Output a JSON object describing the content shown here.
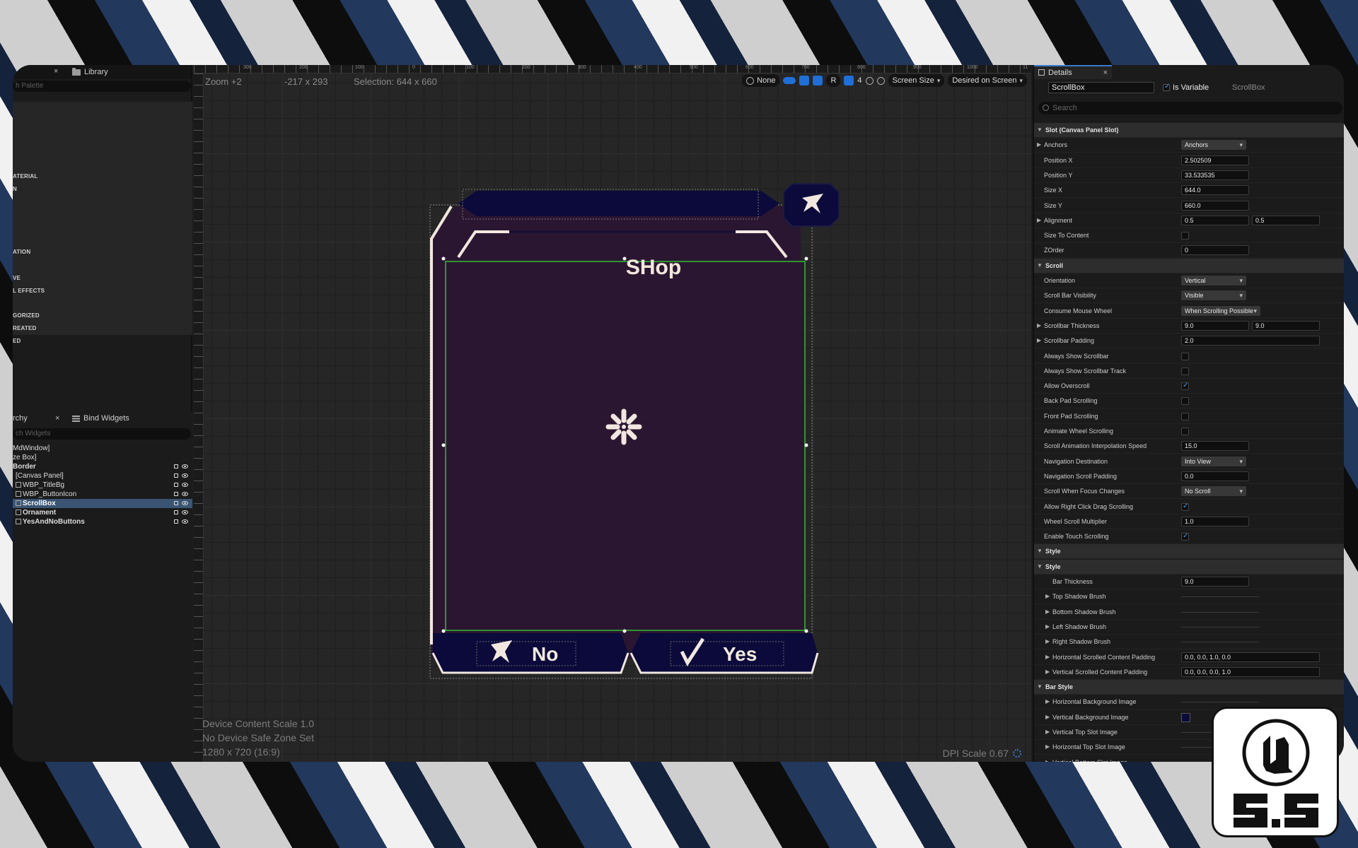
{
  "colors": {
    "accent": "#3b7ac8",
    "widget_fill": "#2b1632",
    "widget_header": "#0b0a3a",
    "widget_border": "#f1e7df",
    "selection": "#2fbf2f"
  },
  "palette": {
    "close_glyph": "×",
    "library_tab": "Library",
    "search_placeholder": "h Palette",
    "categories": [
      "ATERIAL",
      "N",
      "ATION",
      "VE",
      "L EFFECTS",
      "GORIZED",
      "REATED",
      "ED"
    ]
  },
  "hierarchy": {
    "tab_label": "rchy",
    "close_glyph": "×",
    "bind_tab": "Bind Widgets",
    "search_placeholder": "ch Widgets",
    "items": [
      {
        "label": "MdWindow]"
      },
      {
        "label": "ze Box]"
      },
      {
        "label": "Border"
      },
      {
        "label": "[Canvas Panel]"
      },
      {
        "label": "WBP_TitleBg"
      },
      {
        "label": "WBP_ButtonIcon"
      },
      {
        "label": "ScrollBox"
      },
      {
        "label": "Ornament"
      },
      {
        "label": "YesAndNoButtons"
      }
    ]
  },
  "viewport": {
    "zoom": "Zoom +2",
    "cursor": "-217 x 293",
    "selection": "Selection: 644 x 660",
    "ruler_marks": [
      "300",
      "200",
      "100",
      "0",
      "100",
      "200",
      "300",
      "400",
      "500",
      "600",
      "700",
      "800",
      "900",
      "1000",
      "11"
    ],
    "toolbar": {
      "none_label": "None",
      "r_label": "R",
      "grid_value": "4",
      "screen_size": "Screen Size",
      "desired": "Desired on Screen"
    },
    "footer": {
      "scale": "Device Content Scale 1.0",
      "safe_zone": "No Device Safe Zone Set",
      "resolution": "1280 x 720 (16:9)",
      "dpi": "DPI Scale 0.67"
    }
  },
  "widget": {
    "title": "SHop",
    "no_label": "No",
    "yes_label": "Yes",
    "close_icon": "x-mark-icon",
    "loading_icon": "asterisk-loading-icon"
  },
  "details": {
    "tab": "Details",
    "close_glyph": "×",
    "name": "ScrollBox",
    "is_variable": "Is Variable",
    "type": "ScrollBox",
    "search_placeholder": "Search",
    "rows": [
      {
        "kind": "section",
        "label": "Slot (Canvas Panel Slot)"
      },
      {
        "kind": "dropdown",
        "label": "Anchors",
        "value": "Anchors",
        "expand": true
      },
      {
        "kind": "text",
        "label": "Position X",
        "value": "2.502509"
      },
      {
        "kind": "text",
        "label": "Position Y",
        "value": "33.533535"
      },
      {
        "kind": "text",
        "label": "Size X",
        "value": "644.0"
      },
      {
        "kind": "text",
        "label": "Size Y",
        "value": "660.0"
      },
      {
        "kind": "pair",
        "label": "Alignment",
        "value": "0.5",
        "value2": "0.5",
        "expand": true
      },
      {
        "kind": "check",
        "label": "Size To Content",
        "checked": false
      },
      {
        "kind": "text",
        "label": "ZOrder",
        "value": "0"
      },
      {
        "kind": "section",
        "label": "Scroll"
      },
      {
        "kind": "dropdown",
        "label": "Orientation",
        "value": "Vertical"
      },
      {
        "kind": "dropdown",
        "label": "Scroll Bar Visibility",
        "value": "Visible"
      },
      {
        "kind": "dropdown",
        "label": "Consume Mouse Wheel",
        "value": "When Scrolling Possible"
      },
      {
        "kind": "pair",
        "label": "Scrollbar Thickness",
        "value": "9.0",
        "value2": "9.0",
        "expand": true
      },
      {
        "kind": "wide",
        "label": "Scrollbar Padding",
        "value": "2.0",
        "expand": true
      },
      {
        "kind": "check",
        "label": "Always Show Scrollbar",
        "checked": false
      },
      {
        "kind": "check",
        "label": "Always Show Scrollbar Track",
        "checked": false
      },
      {
        "kind": "check",
        "label": "Allow Overscroll",
        "checked": true
      },
      {
        "kind": "check",
        "label": "Back Pad Scrolling",
        "checked": false
      },
      {
        "kind": "check",
        "label": "Front Pad Scrolling",
        "checked": false
      },
      {
        "kind": "check",
        "label": "Animate Wheel Scrolling",
        "checked": false
      },
      {
        "kind": "text",
        "label": "Scroll Animation Interpolation Speed",
        "value": "15.0"
      },
      {
        "kind": "dropdown",
        "label": "Navigation Destination",
        "value": "Into View"
      },
      {
        "kind": "text",
        "label": "Navigation Scroll Padding",
        "value": "0.0"
      },
      {
        "kind": "dropdown",
        "label": "Scroll When Focus Changes",
        "value": "No Scroll"
      },
      {
        "kind": "check",
        "label": "Allow Right Click Drag Scrolling",
        "checked": true
      },
      {
        "kind": "text",
        "label": "Wheel Scroll Multiplier",
        "value": "1.0"
      },
      {
        "kind": "check",
        "label": "Enable Touch Scrolling",
        "checked": true
      },
      {
        "kind": "section",
        "label": "Style"
      },
      {
        "kind": "subsection",
        "label": "Style"
      },
      {
        "kind": "text",
        "label": "Bar Thickness",
        "value": "9.0",
        "indent": true
      },
      {
        "kind": "brush",
        "label": "Top Shadow Brush"
      },
      {
        "kind": "brush",
        "label": "Bottom Shadow Brush"
      },
      {
        "kind": "brush",
        "label": "Left Shadow Brush"
      },
      {
        "kind": "brush",
        "label": "Right Shadow Brush"
      },
      {
        "kind": "widebrush",
        "label": "Horizontal Scrolled Content Padding",
        "value": "0.0, 0.0, 1.0, 0.0"
      },
      {
        "kind": "widebrush",
        "label": "Vertical Scrolled Content Padding",
        "value": "0.0, 0.0, 0.0, 1.0"
      },
      {
        "kind": "subsection",
        "label": "Bar Style"
      },
      {
        "kind": "brush",
        "label": "Horizontal Background Image"
      },
      {
        "kind": "swatch",
        "label": "Vertical Background Image"
      },
      {
        "kind": "brush",
        "label": "Vertical Top Slot Image"
      },
      {
        "kind": "brush",
        "label": "Horizontal Top Slot Image"
      },
      {
        "kind": "brush",
        "label": "Vertical Bottom Slot Image"
      }
    ]
  },
  "badge": {
    "logo_icon": "unreal-engine-logo-icon",
    "version": "5.5"
  }
}
